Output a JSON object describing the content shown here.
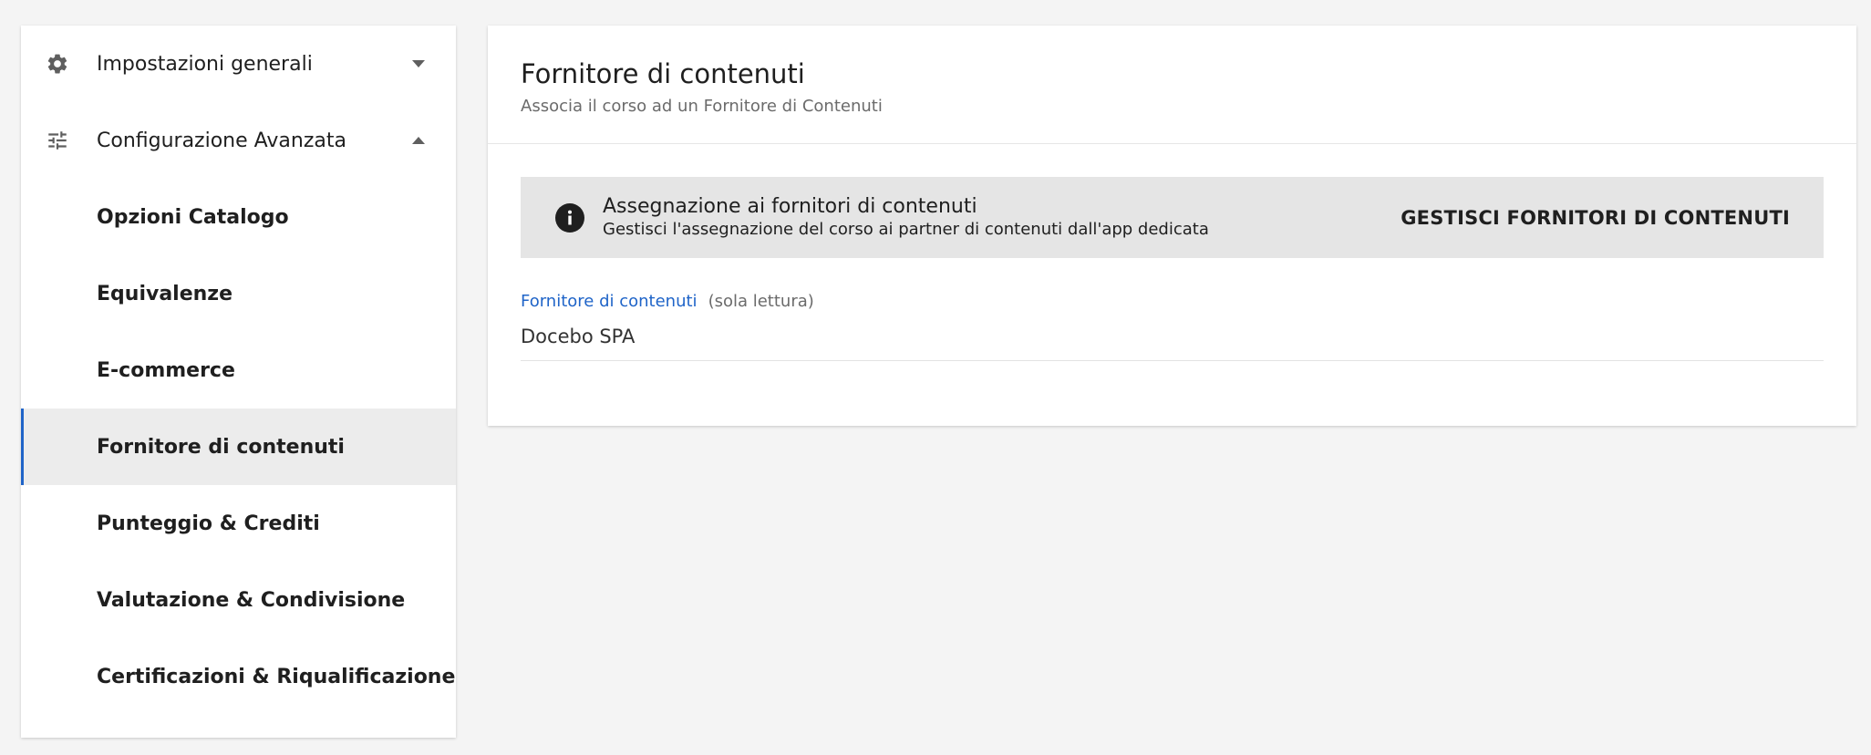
{
  "sidebar": {
    "items": [
      {
        "label": "Impostazioni generali",
        "icon": "gear-icon",
        "caret": "down"
      },
      {
        "label": "Configurazione Avanzata",
        "icon": "sliders-icon",
        "caret": "up"
      },
      {
        "label": "Opzioni Catalogo"
      },
      {
        "label": "Equivalenze"
      },
      {
        "label": "E-commerce"
      },
      {
        "label": "Fornitore di contenuti",
        "active": true
      },
      {
        "label": "Punteggio & Crediti"
      },
      {
        "label": "Valutazione & Condivisione"
      },
      {
        "label": "Certificazioni & Riqualificazione"
      }
    ]
  },
  "panel": {
    "title": "Fornitore di contenuti",
    "subtitle": "Associa il corso ad un Fornitore di Contenuti",
    "info": {
      "icon": "info-icon",
      "title": "Assegnazione ai fornitori di contenuti",
      "description": "Gestisci l'assegnazione del corso ai partner di contenuti dall'app dedicata",
      "action_label": "GESTISCI FORNITORI DI CONTENUTI"
    },
    "field": {
      "label": "Fornitore di contenuti",
      "hint": "(sola lettura)",
      "value": "Docebo SPA"
    }
  },
  "colors": {
    "accent": "#1f64c8",
    "background": "#f4f4f4",
    "info_box": "#e5e5e5",
    "active_item": "#ececec"
  }
}
